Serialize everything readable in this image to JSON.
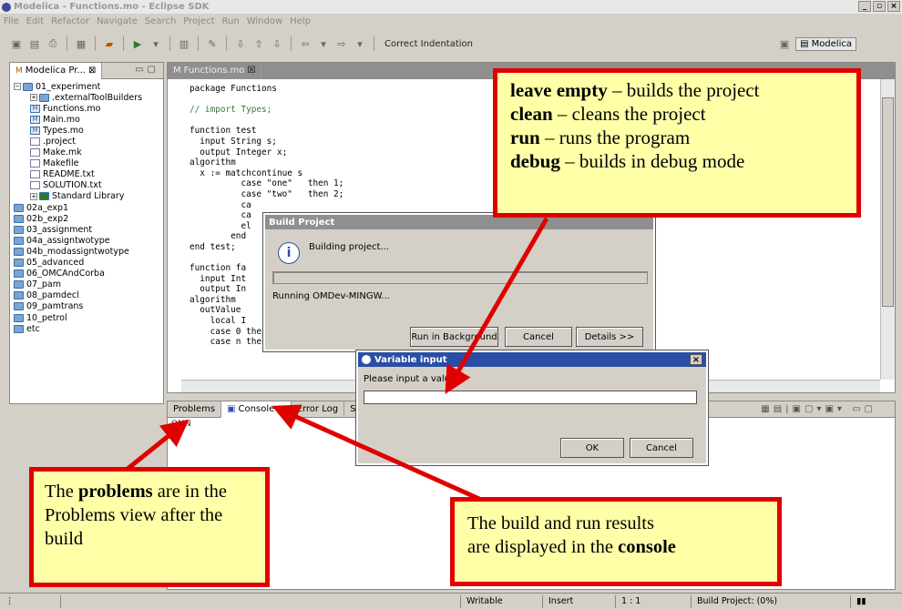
{
  "window": {
    "title": "Modelica - Functions.mo - Eclipse SDK"
  },
  "menu": [
    "File",
    "Edit",
    "Refactor",
    "Navigate",
    "Search",
    "Project",
    "Run",
    "Window",
    "Help"
  ],
  "toolbar": {
    "correct_indentation": "Correct Indentation",
    "perspective": "Modelica"
  },
  "explorer": {
    "tab_label": "Modelica Pr...",
    "items": [
      {
        "label": "01_experiment",
        "type": "project",
        "level": 0
      },
      {
        "label": ".externalToolBuilders",
        "type": "folder",
        "level": 1
      },
      {
        "label": "Functions.mo",
        "type": "mfile",
        "level": 1
      },
      {
        "label": "Main.mo",
        "type": "mfile",
        "level": 1
      },
      {
        "label": "Types.mo",
        "type": "mfile",
        "level": 1
      },
      {
        "label": ".project",
        "type": "xfile",
        "level": 1
      },
      {
        "label": "Make.mk",
        "type": "make",
        "level": 1
      },
      {
        "label": "Makefile",
        "type": "make",
        "level": 1
      },
      {
        "label": "README.txt",
        "type": "file",
        "level": 1
      },
      {
        "label": "SOLUTION.txt",
        "type": "file",
        "level": 1
      },
      {
        "label": "Standard Library",
        "type": "lib",
        "level": 1
      },
      {
        "label": "02a_exp1",
        "type": "folder",
        "level": 0
      },
      {
        "label": "02b_exp2",
        "type": "folder",
        "level": 0
      },
      {
        "label": "03_assignment",
        "type": "folder",
        "level": 0
      },
      {
        "label": "04a_assigntwotype",
        "type": "folder",
        "level": 0
      },
      {
        "label": "04b_modassigntwotype",
        "type": "folder",
        "level": 0
      },
      {
        "label": "05_advanced",
        "type": "folder",
        "level": 0
      },
      {
        "label": "06_OMCAndCorba",
        "type": "folder",
        "level": 0
      },
      {
        "label": "07_pam",
        "type": "folder",
        "level": 0
      },
      {
        "label": "08_pamdecl",
        "type": "folder",
        "level": 0
      },
      {
        "label": "09_pamtrans",
        "type": "folder",
        "level": 0
      },
      {
        "label": "10_petrol",
        "type": "folder",
        "level": 0
      },
      {
        "label": "etc",
        "type": "folder",
        "level": 0
      }
    ]
  },
  "editor": {
    "tab_label": "Functions.mo",
    "code": [
      "package Functions",
      "",
      "// import Types;",
      "",
      "function test",
      "  input String s;",
      "  output Integer x;",
      "algorithm",
      "  x := matchcontinue s",
      "          case \"one\"   then 1;",
      "          case \"two\"   then 2;",
      "          ca",
      "          ca",
      "          el",
      "        end",
      "end test;",
      "",
      "function fa",
      "  input Int",
      "  output In",
      "algorithm",
      "  outValue",
      "    local I",
      "    case 0 then 1;",
      "    case n then n*factoria"
    ]
  },
  "console": {
    "tabs": [
      "Problems",
      "Console",
      "Error Log",
      "S"
    ],
    "content": "OMN"
  },
  "build_dialog": {
    "title": "Build Project",
    "message": "Building project...",
    "status": "Running OMDev-MINGW...",
    "buttons": [
      "Run in Background",
      "Cancel",
      "Details >>"
    ]
  },
  "variable_dialog": {
    "title": "Variable input",
    "prompt": "Please input a value",
    "value": "",
    "ok": "OK",
    "cancel": "Cancel"
  },
  "statusbar": {
    "writable": "Writable",
    "insert": "Insert",
    "position": "1 : 1",
    "progress": "Build Project: (0%)"
  },
  "callouts": {
    "top": [
      {
        "bold": "leave empty",
        "text": " – builds the project"
      },
      {
        "bold": "clean",
        "text": " – cleans the project"
      },
      {
        "bold": "run",
        "text": " – runs the program"
      },
      {
        "bold": "debug",
        "text": " – builds in debug mode"
      }
    ],
    "problems": {
      "pre": "The ",
      "bold": "problems",
      "post": " are in the Problems view after the build"
    },
    "console": {
      "line1": "The build and run results",
      "pre": "are displayed in the ",
      "bold": "console"
    }
  },
  "colors": {
    "callout_border": "#e00000",
    "callout_fill": "#ffffa8",
    "active_title": "#2a4ea5"
  }
}
